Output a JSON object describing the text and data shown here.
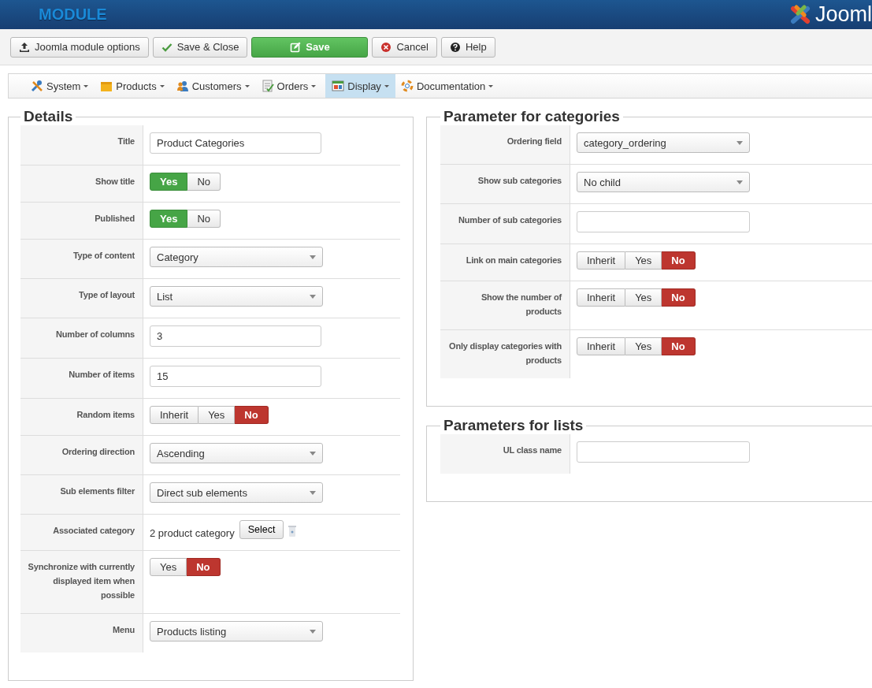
{
  "header": {
    "title": "MODULE",
    "logo_text": "Jooml"
  },
  "toolbar": [
    {
      "label": "Joomla module options",
      "kind": "upload"
    },
    {
      "label": "Save & Close",
      "kind": "check"
    },
    {
      "label": "Save",
      "kind": "save"
    },
    {
      "label": "Cancel",
      "kind": "cancel"
    },
    {
      "label": "Help",
      "kind": "help"
    }
  ],
  "menu": [
    {
      "label": "System",
      "kind": "tools",
      "selected": false
    },
    {
      "label": "Products",
      "kind": "box",
      "selected": false
    },
    {
      "label": "Customers",
      "kind": "users",
      "selected": false
    },
    {
      "label": "Orders",
      "kind": "doc",
      "selected": false
    },
    {
      "label": "Display",
      "kind": "screen",
      "selected": true
    },
    {
      "label": "Documentation",
      "kind": "lifebuoy",
      "selected": false
    }
  ],
  "details": {
    "legend": "Details",
    "fields": [
      {
        "label": "Title",
        "kind": "text",
        "value": "Product Categories"
      },
      {
        "label": "Show title",
        "kind": "toggle",
        "options": [
          {
            "label": "Yes",
            "kind": "yes",
            "selected": true
          },
          {
            "label": "No",
            "kind": "no",
            "selected": false
          }
        ]
      },
      {
        "label": "Published",
        "kind": "toggle",
        "options": [
          {
            "label": "Yes",
            "kind": "yes",
            "selected": true
          },
          {
            "label": "No",
            "kind": "no",
            "selected": false
          }
        ]
      },
      {
        "label": "Type of content",
        "kind": "select",
        "value": "Category"
      },
      {
        "label": "Type of layout",
        "kind": "select",
        "value": "List"
      },
      {
        "label": "Number of columns",
        "kind": "text",
        "value": "3"
      },
      {
        "label": "Number of items",
        "kind": "text",
        "value": "15"
      },
      {
        "label": "Random items",
        "kind": "toggle",
        "options": [
          {
            "label": "Inherit",
            "kind": "inherit",
            "selected": false
          },
          {
            "label": "Yes",
            "kind": "yes",
            "selected": false
          },
          {
            "label": "No",
            "kind": "no",
            "selected": true
          }
        ]
      },
      {
        "label": "Ordering direction",
        "kind": "select",
        "value": "Ascending"
      },
      {
        "label": "Sub elements filter",
        "kind": "select",
        "value": "Direct sub elements"
      },
      {
        "label": "Associated category",
        "kind": "category",
        "value": "2 product category",
        "button": "Select"
      },
      {
        "label": "Synchronize with currently displayed item when possible",
        "kind": "toggle",
        "options": [
          {
            "label": "Yes",
            "kind": "yes",
            "selected": false
          },
          {
            "label": "No",
            "kind": "no",
            "selected": true
          }
        ]
      },
      {
        "label": "Menu",
        "kind": "select",
        "value": "Products listing"
      }
    ]
  },
  "categories": {
    "legend": "Parameter for categories",
    "fields": [
      {
        "label": "Ordering field",
        "kind": "select",
        "value": "category_ordering"
      },
      {
        "label": "Show sub categories",
        "kind": "select",
        "value": "No child"
      },
      {
        "label": "Number of sub categories",
        "kind": "text"
      },
      {
        "label": "Link on main categories",
        "kind": "toggle",
        "options": [
          {
            "label": "Inherit",
            "kind": "inherit",
            "selected": false
          },
          {
            "label": "Yes",
            "kind": "yes",
            "selected": false
          },
          {
            "label": "No",
            "kind": "no",
            "selected": true
          }
        ]
      },
      {
        "label": "Show the number of products",
        "kind": "toggle",
        "options": [
          {
            "label": "Inherit",
            "kind": "inherit",
            "selected": false
          },
          {
            "label": "Yes",
            "kind": "yes",
            "selected": false
          },
          {
            "label": "No",
            "kind": "no",
            "selected": true
          }
        ]
      },
      {
        "label": "Only display categories with products",
        "kind": "toggle",
        "options": [
          {
            "label": "Inherit",
            "kind": "inherit",
            "selected": false
          },
          {
            "label": "Yes",
            "kind": "yes",
            "selected": false
          },
          {
            "label": "No",
            "kind": "no",
            "selected": true
          }
        ]
      }
    ]
  },
  "lists": {
    "legend": "Parameters for lists",
    "fields": [
      {
        "label": "UL class name",
        "kind": "text"
      }
    ]
  }
}
